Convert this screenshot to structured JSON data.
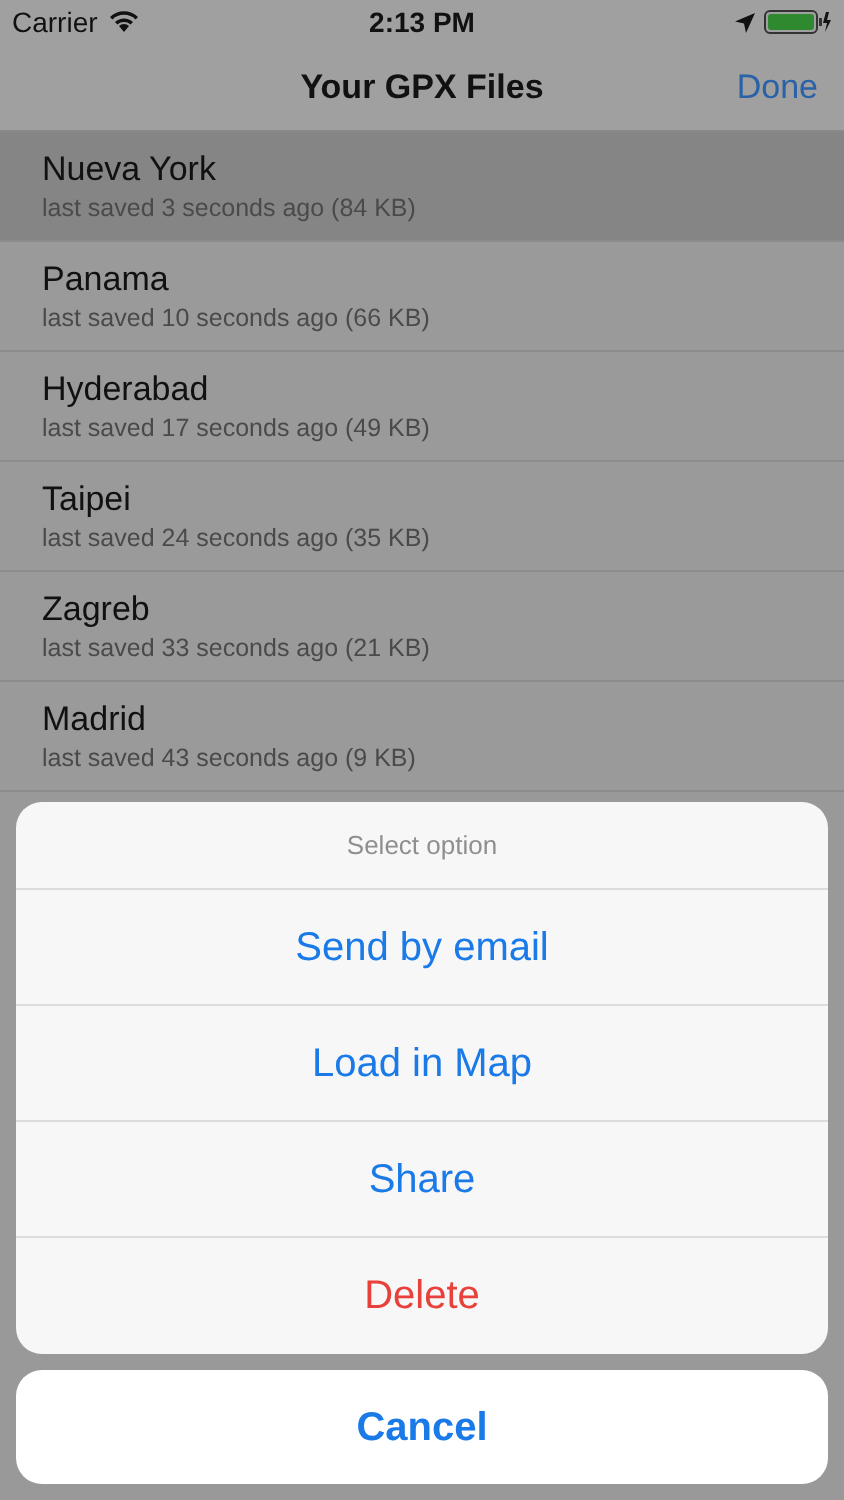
{
  "status_bar": {
    "carrier": "Carrier",
    "time": "2:13 PM"
  },
  "nav": {
    "title": "Your GPX Files",
    "done": "Done"
  },
  "files": [
    {
      "name": "Nueva York",
      "detail": "last saved 3 seconds ago (84 KB)",
      "selected": true
    },
    {
      "name": "Panama",
      "detail": "last saved 10 seconds ago (66 KB)",
      "selected": false
    },
    {
      "name": "Hyderabad",
      "detail": "last saved 17 seconds ago (49 KB)",
      "selected": false
    },
    {
      "name": "Taipei",
      "detail": "last saved 24 seconds ago (35 KB)",
      "selected": false
    },
    {
      "name": "Zagreb",
      "detail": "last saved 33 seconds ago (21 KB)",
      "selected": false
    },
    {
      "name": "Madrid",
      "detail": "last saved 43 seconds ago (9 KB)",
      "selected": false
    }
  ],
  "action_sheet": {
    "title": "Select option",
    "options": [
      {
        "label": "Send by email",
        "kind": "default"
      },
      {
        "label": "Load in Map",
        "kind": "default"
      },
      {
        "label": "Share",
        "kind": "default"
      },
      {
        "label": "Delete",
        "kind": "destructive"
      }
    ],
    "cancel": "Cancel"
  }
}
